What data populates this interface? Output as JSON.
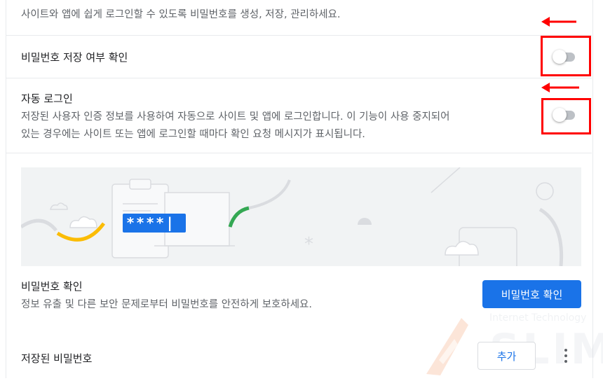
{
  "intro": {
    "description": "사이트와 앱에 쉽게 로그인할 수 있도록 비밀번호를 생성, 저장, 관리하세요."
  },
  "settings": {
    "offer_to_save": {
      "label": "비밀번호 저장 여부 확인",
      "enabled": false
    },
    "auto_signin": {
      "label": "자동 로그인",
      "description_line1": "저장된 사용자 인증 정보를 사용하여 자동으로 사이트 및 앱에 로그인합니다. 이 기능이 사용 중지되어",
      "description_line2": "있는 경우에는 사이트 또는 앱에 로그인할 때마다 확인 요청 메시지가 표시됩니다.",
      "enabled": false
    }
  },
  "banner": {
    "password_mask": "****|"
  },
  "checkup": {
    "title": "비밀번호 확인",
    "description": "정보 유출 및 다른 보안 문제로부터 비밀번호를 안전하게 보호하세요.",
    "button_label": "비밀번호 확인"
  },
  "saved_passwords": {
    "title": "저장된 비밀번호",
    "add_button_label": "추가"
  },
  "watermark": {
    "subtitle": "Internet Technology",
    "title": "SLIM"
  },
  "colors": {
    "accent_blue": "#1a73e8",
    "annotation_red": "#ff0000",
    "toggle_off": "#bdc1c6"
  }
}
